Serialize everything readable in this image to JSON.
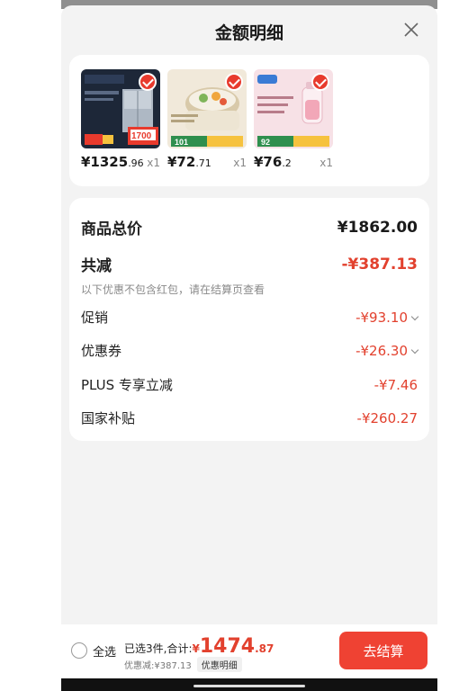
{
  "header": {
    "title": "金额明细"
  },
  "products": [
    {
      "price_int": "¥1325",
      "price_dec": ".96",
      "qty": "x1",
      "image": "refrigerator"
    },
    {
      "price_int": "¥72",
      "price_dec": ".71",
      "qty": "x1",
      "image": "rice-cooker"
    },
    {
      "price_int": "¥76",
      "price_dec": ".2",
      "qty": "x1",
      "image": "juicer"
    }
  ],
  "summary": {
    "total_label": "商品总价",
    "total_value": "¥1862.00",
    "reduce_label": "共减",
    "reduce_value": "-¥387.13",
    "note": "以下优惠不包含红包，请在结算页查看",
    "promo_label": "促销",
    "promo_value": "-¥93.10",
    "coupon_label": "优惠券",
    "coupon_value": "-¥26.30",
    "plus_label": "PLUS 专享立减",
    "plus_value": "-¥7.46",
    "subsidy_label": "国家补贴",
    "subsidy_value": "-¥260.27"
  },
  "footer": {
    "select_all": "全选",
    "selected_text": "已选3件,合计:",
    "currency": "¥",
    "amount_int": "1474",
    "amount_dec": ".87",
    "discount_text": "优惠减:¥387.13",
    "detail_button": "优惠明细",
    "checkout_button": "去结算"
  },
  "colors": {
    "accent": "#e2412e",
    "checkout": "#ef4233"
  }
}
